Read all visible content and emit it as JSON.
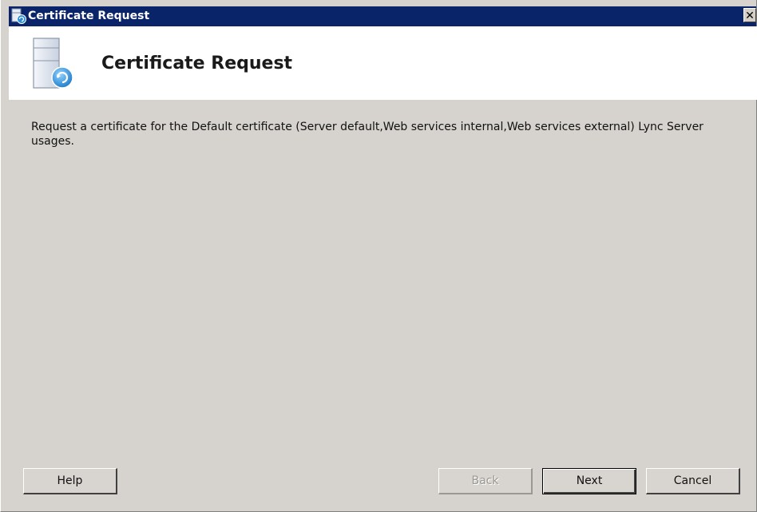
{
  "window": {
    "title": "Certificate Request",
    "close_glyph": "✕"
  },
  "header": {
    "title": "Certificate Request",
    "icon": "server-refresh-icon"
  },
  "body": {
    "description": "Request a certificate for the Default certificate (Server default,Web services internal,Web services external) Lync Server usages."
  },
  "buttons": {
    "help": "Help",
    "back": "Back",
    "next": "Next",
    "cancel": "Cancel"
  },
  "colors": {
    "titlebar": "#0a246a",
    "dialog_background": "#d6d3ce",
    "header_background": "#ffffff"
  }
}
